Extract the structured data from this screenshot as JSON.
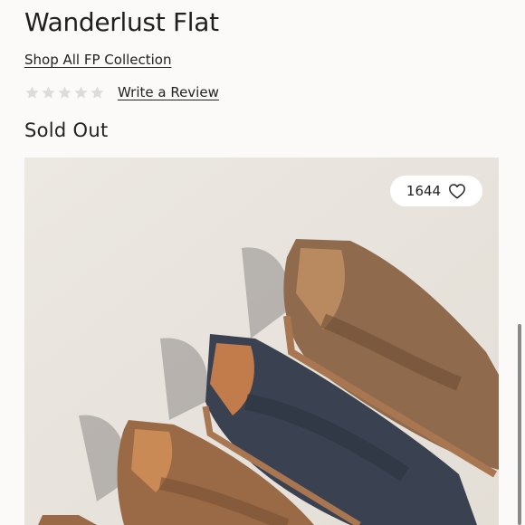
{
  "product": {
    "title": "Wanderlust Flat",
    "collection_link": "Shop All FP Collection",
    "rating": {
      "value": 0,
      "max": 5
    },
    "write_review_label": "Write a Review",
    "status": "Sold Out",
    "likes": "1644"
  },
  "icons": {
    "star": "star-icon",
    "heart": "heart-outline-icon"
  },
  "colors": {
    "star_empty": "#dcdcdc",
    "background": "#fcfaf8",
    "text": "#222222"
  }
}
